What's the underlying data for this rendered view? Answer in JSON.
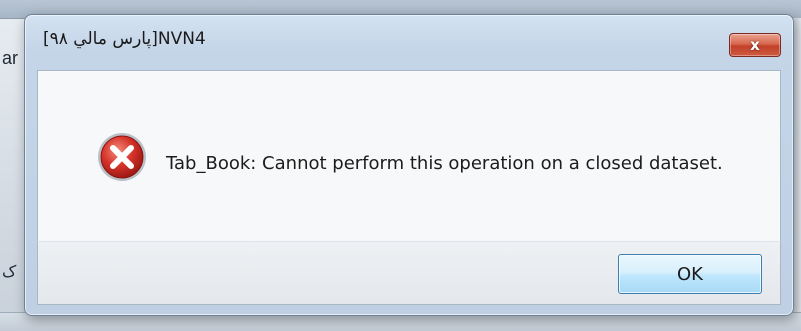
{
  "dialog": {
    "title": "[پارس مالي ۹۸]NVN4",
    "message": "Tab_Book: Cannot perform this operation on a closed dataset.",
    "ok_label": "OK",
    "close_label": "x",
    "icon": "error-icon"
  },
  "background": {
    "left_text_top": "ar",
    "left_text_bottom": "ک"
  },
  "colors": {
    "close_button": "#c2412a",
    "ok_border": "#3c7fb1",
    "frame": "#c4d5e8"
  }
}
